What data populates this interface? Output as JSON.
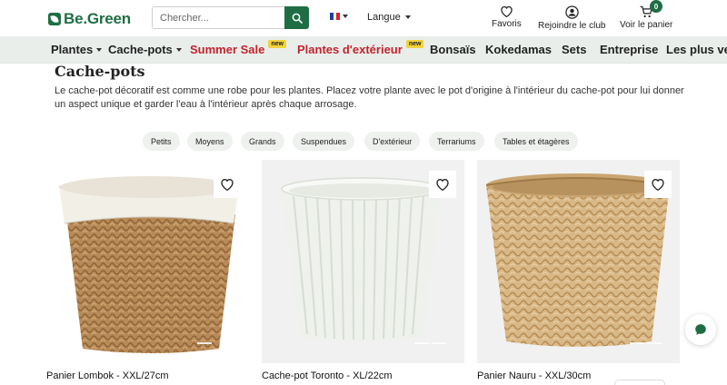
{
  "header": {
    "logo_text": "Be.Green",
    "search_placeholder": "Chercher...",
    "language_label": "Langue",
    "favorites_label": "Favoris",
    "club_label": "Rejoindre le club",
    "cart_label": "Voir le panier",
    "cart_count": "0"
  },
  "nav": {
    "items": [
      {
        "label": "Plantes",
        "caret": true
      },
      {
        "label": "Cache-pots",
        "caret": true
      },
      {
        "label": "Summer Sale",
        "badge": "new",
        "color": "#c4242c"
      },
      {
        "label": "Plantes d'extérieur",
        "badge": "new",
        "color": "#c4242c"
      },
      {
        "label": "Bonsaïs"
      },
      {
        "label": "Kokedamas"
      },
      {
        "label": "Sets"
      },
      {
        "label": "Entreprise"
      },
      {
        "label": "Les plus ven"
      }
    ]
  },
  "page": {
    "title": "Cache-pots",
    "description": "Le cache-pot décoratif est comme une robe pour les plantes. Placez votre plante avec le pot d'origine à l'intérieur du cache-pot pour lui donner un aspect unique et garder l'eau à l'intérieur après chaque arrosage."
  },
  "filters": [
    "Petits",
    "Moyens",
    "Grands",
    "Suspendues",
    "D'extérieur",
    "Terrariums",
    "Tables et étagères"
  ],
  "products": [
    {
      "name": "Panier Lombok - XXL/27cm"
    },
    {
      "name": "Cache-pot Toronto - XL/22cm"
    },
    {
      "name": "Panier Nauru - XXL/30cm"
    }
  ],
  "colors": {
    "brand": "#1f6e43",
    "nav_bg": "#e9eeeb",
    "sale_red": "#c4242c",
    "badge_yellow": "#f2d33a"
  }
}
